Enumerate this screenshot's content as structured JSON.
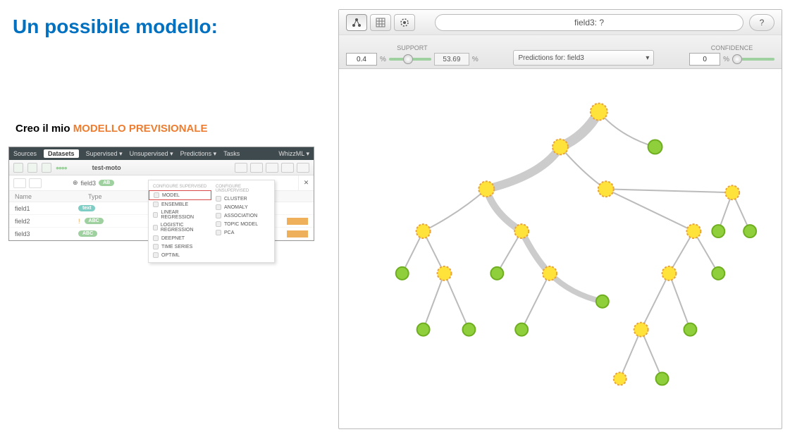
{
  "title": "Un possibile modello:",
  "subtitle_prefix": "Creo il mio ",
  "subtitle_highlight": "MODELLO PREVISIONALE",
  "mini": {
    "nav": [
      "Sources",
      "Datasets",
      "Supervised ▾",
      "Unsupervised ▾",
      "Predictions ▾",
      "Tasks"
    ],
    "nav_active": "Datasets",
    "nav_right": "WhizzML ▾",
    "dataset_name": "test-moto",
    "selected_field": "field3",
    "selected_pill": "AB",
    "headers": [
      "Name",
      "Type"
    ],
    "fields": [
      {
        "name": "field1",
        "pill": "text",
        "pill_color": "teal"
      },
      {
        "name": "field2",
        "pill": "ABC",
        "pill_color": "green",
        "warn": true
      },
      {
        "name": "field3",
        "pill": "ABC",
        "pill_color": "green"
      }
    ],
    "close": "✕"
  },
  "dropdown": {
    "left_head": "CONFIGURE SUPERVISED",
    "right_head": "CONFIGURE UNSUPERVISED",
    "left": [
      "MODEL",
      "ENSEMBLE",
      "LINEAR REGRESSION",
      "LOGISTIC REGRESSION",
      "DEEPNET",
      "TIME SERIES",
      "OPTIML"
    ],
    "right": [
      "CLUSTER",
      "ANOMALY",
      "ASSOCIATION",
      "TOPIC MODEL",
      "PCA"
    ]
  },
  "tree": {
    "path_text": "field3: ?",
    "help": "?",
    "support_label": "SUPPORT",
    "support_value": "0.4",
    "support_readonly": "53.69",
    "pct": "%",
    "predictions_label": "Predictions for: field3",
    "confidence_label": "CONFIDENCE",
    "confidence_value": "0",
    "dropdown_caret": "▾",
    "icons": {
      "tree": "tree-view-icon",
      "table": "table-view-icon",
      "sunburst": "sunburst-view-icon"
    }
  }
}
